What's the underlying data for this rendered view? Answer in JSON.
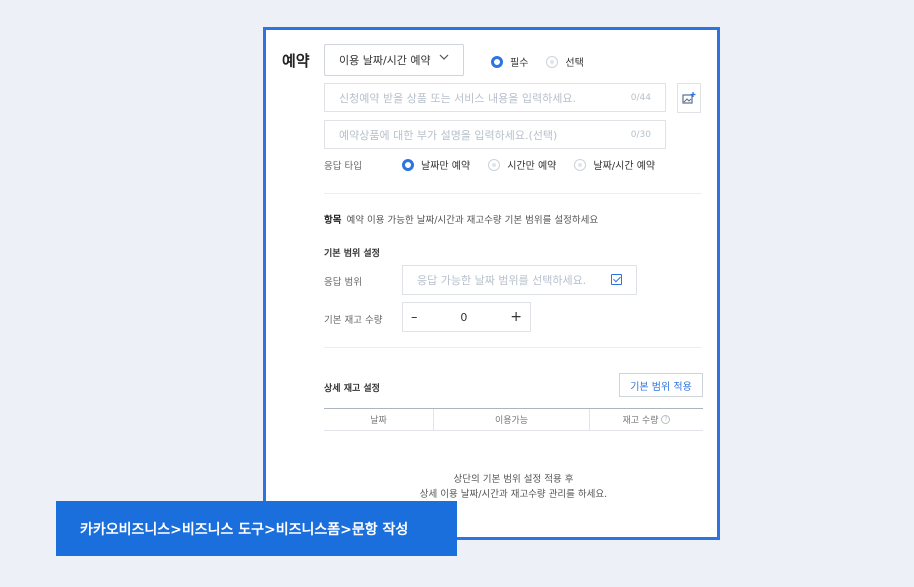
{
  "section": {
    "title": "예약",
    "type_dropdown": "이용 날짜/시간 예약",
    "required_options": [
      "필수",
      "선택"
    ]
  },
  "inputs": {
    "product_placeholder": "신청예약 받을 상품 또는 서비스 내용을 입력하세요.",
    "product_count": "0/44",
    "desc_placeholder": "예약상품에 대한 부가 설명을 입력하세요.(선택)",
    "desc_count": "0/30"
  },
  "response_type": {
    "label": "응답 타입",
    "options": [
      "날짜만 예약",
      "시간만 예약",
      "날짜/시간 예약"
    ]
  },
  "item": {
    "title": "항목",
    "description": "예약 이용 가능한 날짜/시간과 재고수량 기본 범위를 설정하세요"
  },
  "basic_range": {
    "title": "기본 범위 설정",
    "range_label": "응답 범위",
    "range_placeholder": "응답 가능한 날짜 범위를 선택하세요.",
    "stock_label": "기본 재고 수량",
    "stock_value": "0"
  },
  "detail_stock": {
    "title": "상세 재고 설정",
    "apply_button": "기본 범위 적용",
    "columns": [
      "날짜",
      "이용가능",
      "재고 수량"
    ],
    "empty_line1": "상단의 기본 범위 설정 적용 후",
    "empty_line2": "상세 이용 날짜/시간과 재고수량 관리를 하세요."
  },
  "caption": "카카오비즈니스>비즈니스 도구>비즈니스폼>문항 작성",
  "colors": {
    "accent": "#2e74e0",
    "caption_bg": "#1a6fdc"
  }
}
